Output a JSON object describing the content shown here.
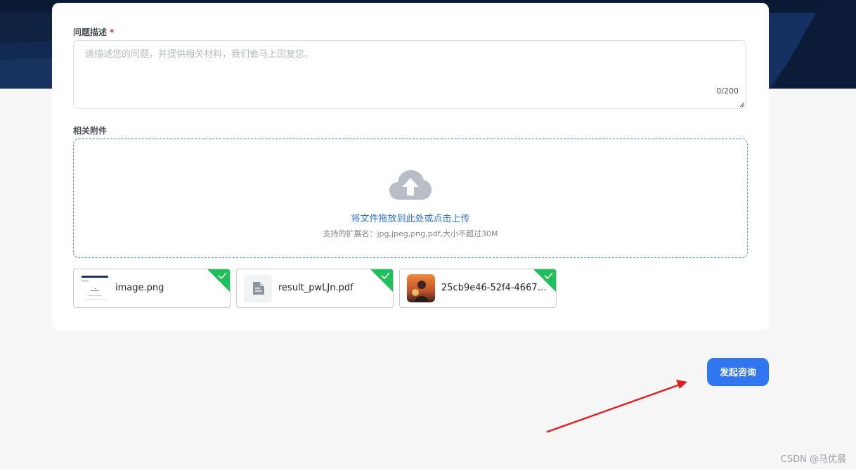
{
  "form": {
    "description": {
      "label": "问题描述",
      "required_mark": "*",
      "placeholder": "请描述您的问题，并提供相关材料，我们会马上回复您。",
      "counter": "0/200"
    },
    "attachments": {
      "label": "相关附件",
      "drop_text": "将文件拖放到此处或点击上传",
      "hint": "支持的扩展名：jpg,jpeg,png,pdf,大小不超过30M",
      "files": [
        {
          "name": "image.png",
          "kind": "image-thumbnail"
        },
        {
          "name": "result_pwLJn.pdf",
          "kind": "document-icon"
        },
        {
          "name": "25cb9e46-52f4-4667-…",
          "kind": "photo-thumbnail"
        }
      ]
    },
    "submit_label": "发起咨询"
  },
  "watermark": "CSDN @马优晨",
  "colors": {
    "primary": "#2f76f0",
    "link": "#2f72d8",
    "success": "#1fbf5c",
    "required": "#e5322d",
    "hero_bg": "#0f2242",
    "annotation": "#e81c1c"
  }
}
